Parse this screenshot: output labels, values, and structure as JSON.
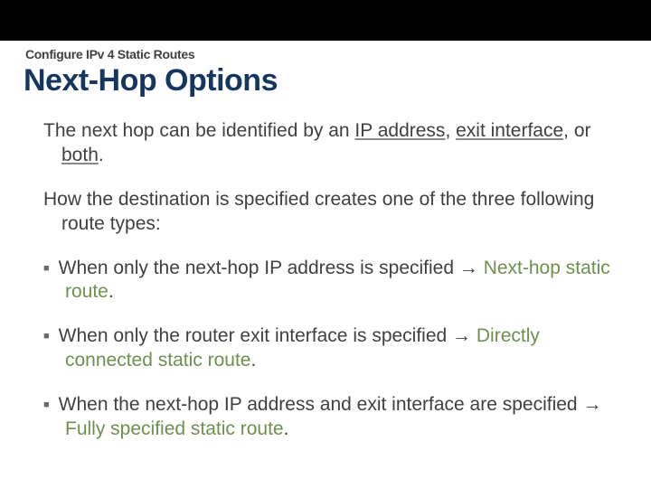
{
  "pretitle": "Configure IPv 4 Static Routes",
  "title": "Next-Hop Options",
  "para1": {
    "prefix": "The next hop can be identified by an ",
    "u1": "IP address",
    "sep1": ", ",
    "u2": "exit interface",
    "sep2": ", or ",
    "u3": "both",
    "suffix": "."
  },
  "para2": "How the destination is specified creates one of the three following route types:",
  "bullets": [
    {
      "lead": "When only the next-hop IP address is specified ",
      "arrow": "→ ",
      "hl": "Next-hop static route",
      "tail": "."
    },
    {
      "lead": "When only the router exit interface is specified ",
      "arrow": "→ ",
      "hl": "Directly connected static route",
      "tail": "."
    },
    {
      "lead": "When the next-hop IP address and exit interface are specified ",
      "arrow": "→ ",
      "hl": "Fully specified static route",
      "tail": "."
    }
  ]
}
